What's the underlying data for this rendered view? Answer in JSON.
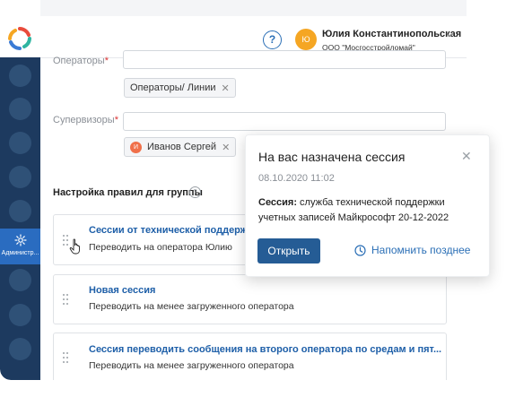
{
  "header": {
    "help_icon": "question-circle-icon",
    "user": {
      "initials": "Ю",
      "name": "Юлия Константинопольская",
      "org": "ООО \"Мосгосстройломай\""
    }
  },
  "sidebar": {
    "active_item_label": "Администр..."
  },
  "form": {
    "operators_label": "Операторы",
    "operators_chip": "Операторы/ Линии",
    "supervisors_label": "Супервизоры",
    "supervisor_chip_initial": "И",
    "supervisor_chip": "Иванов Сергей",
    "required_mark": "*",
    "chip_remove": "✕"
  },
  "rules": {
    "section_title": "Настройка правил для группы",
    "help_mark": "?",
    "items": [
      {
        "title": "Сессии от технической поддержки",
        "desc": "Переводить на оператора Юлию"
      },
      {
        "title": "Новая сессия",
        "desc": "Переводить на менее загруженного оператора"
      },
      {
        "title": "Сессия переводить сообщения на второго оператора по средам и пят...",
        "desc": "Переводить на менее загруженного оператора"
      }
    ]
  },
  "popup": {
    "title": "На вас назначена сессия",
    "close": "✕",
    "date": "08.10.2020 11:02",
    "body_label": "Сессия:",
    "body_text": " служба технической поддержки учетных записей Майкрософт 20-12-2022",
    "open_label": "Открыть",
    "remind_label": "Напомнить позднее"
  },
  "colors": {
    "sidebar": "#1d3a5f",
    "active": "#2a6cc0",
    "primary_button": "#255c95",
    "link": "#1e5fa8"
  }
}
